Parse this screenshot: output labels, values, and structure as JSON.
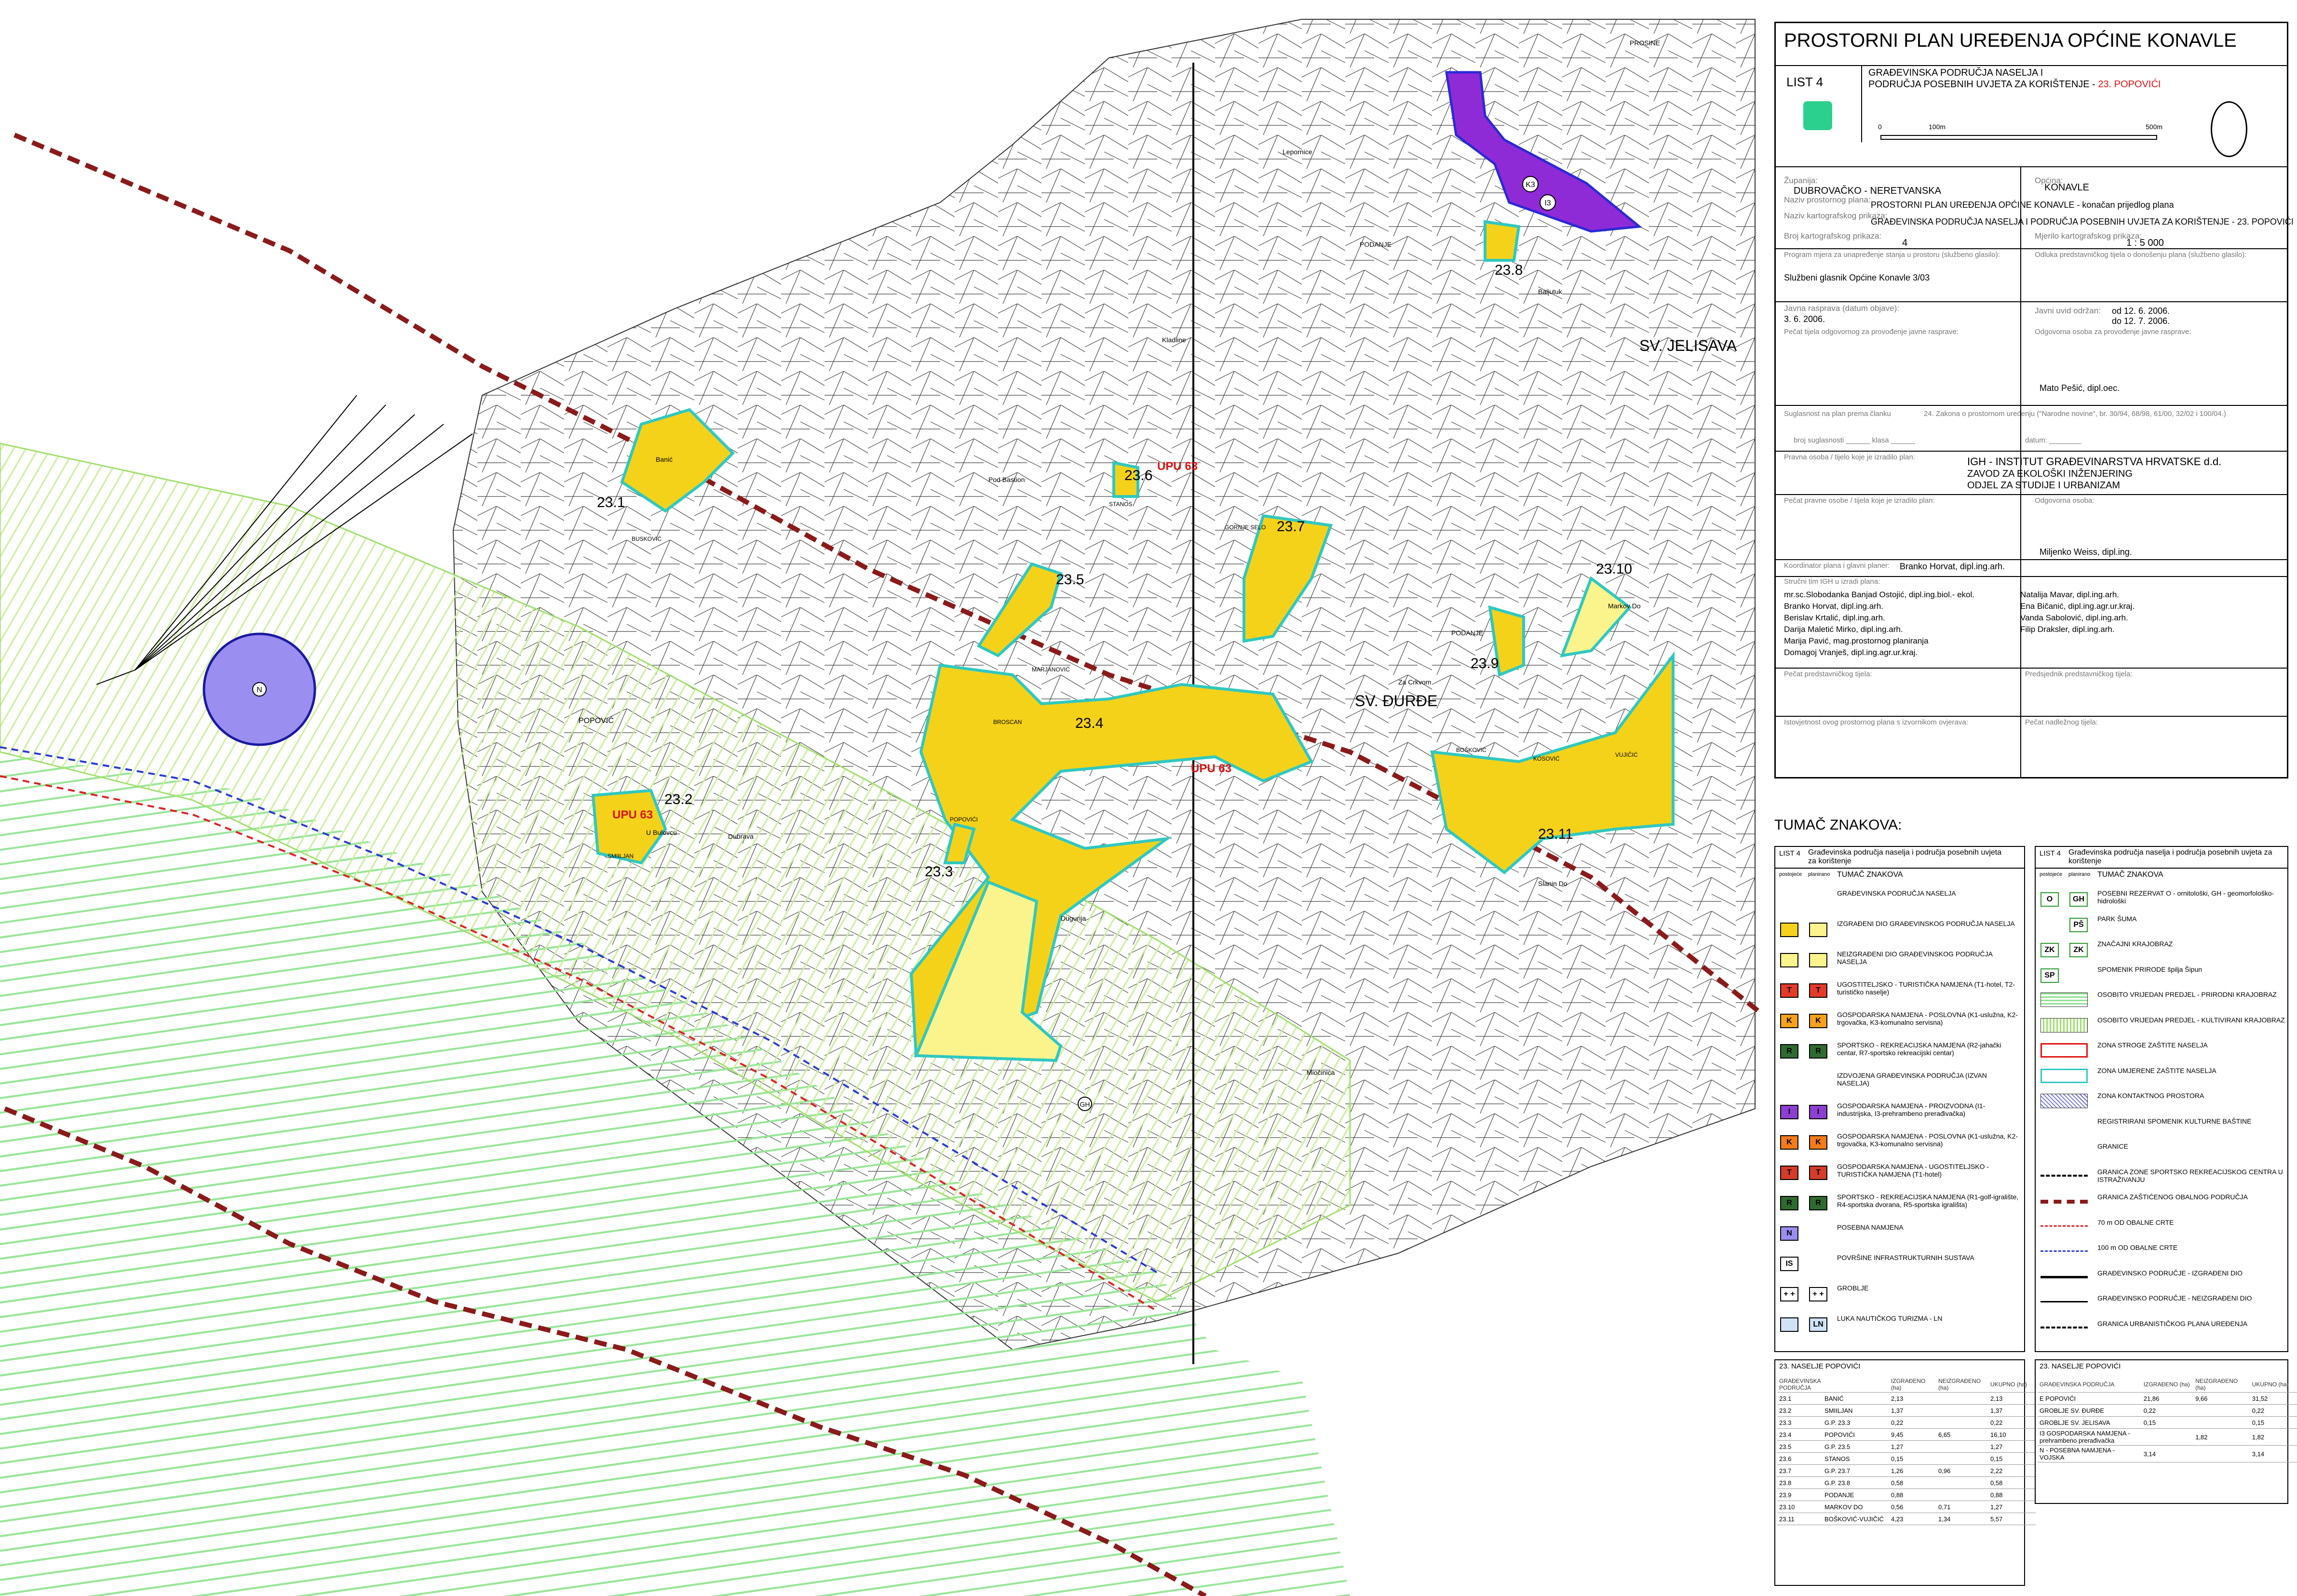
{
  "title": "PROSTORNI PLAN UREĐENJA OPĆINE KONAVLE",
  "sheet": {
    "list_no": "LIST 4",
    "subtitle_line1": "GRAĐEVINSKA PODRUČJA NASELJA I",
    "subtitle_line2": "PODRUČJA POSEBNIH UVJETA ZA KORIŠTENJE - ",
    "subtitle_highlight": "23. POPOVIĆI",
    "scale_bar": {
      "zero": "0",
      "mid": "100m",
      "end": "500m"
    },
    "fields": [
      {
        "label": "Županija:",
        "value": "DUBROVAČKO - NERETVANSKA"
      },
      {
        "label": "Općina:",
        "value": "KONAVLE"
      },
      {
        "label": "Naziv prostornog plana:",
        "value": "PROSTORNI PLAN UREĐENJA OPĆINE KONAVLE - konačan prijedlog plana"
      },
      {
        "label": "Naziv kartografskog prikaza:",
        "value": "GRAĐEVINSKA PODRUČJA NASELJA I PODRUČJA POSEBNIH UVJETA ZA KORIŠTENJE - 23. POPOVIĆI"
      },
      {
        "label": "Broj kartografskog prikaza:",
        "value": "4"
      },
      {
        "label": "Mjerilo kartografskog prikaza:",
        "value": "1 : 5 000"
      },
      {
        "label": "Program mjera za unapređenje stanja u prostoru (službeno glasilo):",
        "value": "Službeni glasnik Općine Konavle 3/03"
      },
      {
        "label": "Odluka predstavničkog tijela o donošenju plana (službeno glasilo):",
        "value": ""
      },
      {
        "label": "Javna rasprava (datum objave):",
        "value": "3. 6. 2006."
      },
      {
        "label": "Javni uvid održan:",
        "value": "od 12. 6. 2006. do 12. 7. 2006."
      },
      {
        "label": "Pečat tijela odgovornog za provođenje javne rasprave:",
        "value": ""
      },
      {
        "label": "Odgovorna osoba za provođenje javne rasprave:",
        "value": "Mato Pešić, dipl.oec."
      },
      {
        "label": "Suglasnost na plan prema članku",
        "value": "24. Zakona o prostornom uređenju (\"Narodne novine\", br. 30/94, 68/98, 61/00, 32/02 i 100/04.)"
      },
      {
        "label": "broj suglasnosti ______ klasa ______",
        "value": "datum: ________"
      },
      {
        "label": "Pravna osoba / tijelo koje je izradilo plan:",
        "value": "IGH - INSTITUT GRAĐEVINARSTVA HRVATSKE d.d."
      },
      {
        "label": "",
        "value": "ZAVOD ZA EKOLOŠKI INŽENJERING"
      },
      {
        "label": "",
        "value": "ODJEL ZA STUDIJE I URBANIZAM"
      },
      {
        "label": "Pečat pravne osobe / tijela koje je izradilo plan:",
        "value": ""
      },
      {
        "label": "Odgovorna osoba:",
        "value": "Miljenko Weiss, dipl.ing."
      },
      {
        "label": "Koordinator plana i glavni planer:",
        "value": "Branko Horvat, dipl.ing.arh."
      },
      {
        "label": "Stručni tim IGH u izradi plana:",
        "value": ""
      },
      {
        "label": "Pečat predstavničkog tijela:",
        "value": ""
      },
      {
        "label": "Predsjednik predstavničkog tijela:",
        "value": ""
      },
      {
        "label": "Istovjetnost ovog prostornog plana s izvornikom ovjerava:",
        "value": ""
      },
      {
        "label": "Pečat nadležnog tijela:",
        "value": ""
      }
    ],
    "team_left": [
      "mr.sc.Slobodanka Banjad Ostojić, dipl.ing.biol.- ekol.",
      "Branko Horvat, dipl.ing.arh.",
      "Berislav Krtalić, dipl.ing.arh.",
      "Darija Maletić Mirko, dipl.ing.arh.",
      "Marija Pavić, mag.prostornog planiranja",
      "Domagoj Vranješ, dipl.ing.agr.ur.kraj."
    ],
    "team_right": [
      "Natalija Mavar, dipl.ing.arh.",
      "Ena Bičanić, dipl.ing.agr.ur.kraj.",
      "Vanda Sabolović, dipl.ing.arh.",
      "Filip Draksler, dipl.ing.arh."
    ]
  },
  "legend": {
    "heading": "TUMAČ ZNAKOVA:",
    "left_header": "Građevinska područja naselja i područja posebnih uvjeta za korištenje",
    "left_sub": "TUMAČ ZNAKOVA",
    "right_header": "Građevinska područja naselja i područja posebnih uvjeta za korištenje",
    "right_sub": "TUMAČ ZNAKOVA",
    "col_a": "postojeće",
    "col_b": "planirano",
    "left_items": [
      {
        "text": "GRAĐEVINSKA PODRUČJA NASELJA",
        "a": "",
        "b": "",
        "color": ""
      },
      {
        "text": "IZGRAĐENI DIO GRAĐEVINSKOG PODRUČJA NASELJA",
        "a": "",
        "b": "",
        "color": "#f5d21a"
      },
      {
        "text": "NEIZGRAĐENI DIO GRAĐEVINSKOG PODRUČJA NASELJA",
        "a": "",
        "b": "",
        "color": "#fbf48c"
      },
      {
        "text": "UGOSTITELJSKO - TURISTIČKA NAMJENA (T1-hotel, T2-turističko naselje)",
        "a": "T",
        "b": "T",
        "color": "#e43a2a"
      },
      {
        "text": "GOSPODARSKA NAMJENA - POSLOVNA (K1-uslužna, K2-trgovačka, K3-komunalno servisna)",
        "a": "K",
        "b": "K",
        "color": "#f7a21b"
      },
      {
        "text": "SPORTSKO - REKREACIJSKA NAMJENA (R2-jahački centar, R7-sportsko rekreacijski centar)",
        "a": "R",
        "b": "R",
        "color": "#2f6b2f"
      },
      {
        "text": "IZDVOJENA GRAĐEVINSKA PODRUČJA (IZVAN NASELJA)",
        "a": "",
        "b": "",
        "color": ""
      },
      {
        "text": "GOSPODARSKA NAMJENA - PROIZVODNA (I1-industrijska, I3-prehrambeno prerađivačka)",
        "a": "I",
        "b": "I",
        "color": "#8d3fd1"
      },
      {
        "text": "GOSPODARSKA NAMJENA - POSLOVNA (K1-uslužna, K2-trgovačka, K3-komunalno servisna)",
        "a": "K",
        "b": "K",
        "color": "#f47b1b"
      },
      {
        "text": "GOSPODARSKA NAMJENA - UGOSTITELJSKO - TURISTIČKA NAMJENA (T1-hotel)",
        "a": "T",
        "b": "T",
        "color": "#d43c2b"
      },
      {
        "text": "SPORTSKO - REKREACIJSKA NAMJENA (R1-golf-igralište, R4-sportska dvorana, R5-sportska igrališta)",
        "a": "R",
        "b": "R",
        "color": "#2f6b2f"
      },
      {
        "text": "POSEBNA NAMJENA",
        "a": "N",
        "b": "",
        "color": "#9a8ef0"
      },
      {
        "text": "POVRŠINE INFRASTRUKTURNIH SUSTAVA",
        "a": "IS",
        "b": "",
        "color": "#ffffff"
      },
      {
        "text": "GROBLJE",
        "a": "+ +",
        "b": "+ +",
        "color": "#ffffff"
      },
      {
        "text": "LUKA NAUTIČKOG TURIZMA - LN",
        "a": "",
        "b": "LN",
        "color": "#cfe3f5"
      }
    ],
    "right_items": [
      {
        "text": "POSEBNI REZERVAT O - ornitološki, GH - geomorfološko-hidrološki",
        "a": "O",
        "b": "GH"
      },
      {
        "text": "PARK ŠUMA",
        "a": "",
        "b": "PŠ"
      },
      {
        "text": "ZNAČAJNI KRAJOBRAZ",
        "a": "ZK",
        "b": "ZK"
      },
      {
        "text": "SPOMENIK PRIRODE špilja Šipun",
        "a": "SP",
        "b": ""
      },
      {
        "text": "OSOBITO VRIJEDAN PREDJEL - PRIRODNI KRAJOBRAZ",
        "a": "",
        "b": ""
      },
      {
        "text": "OSOBITO VRIJEDAN PREDJEL - KULTIVIRANI KRAJOBRAZ",
        "a": "",
        "b": ""
      },
      {
        "text": "ZONA STROGE ZAŠTITE NASELJA",
        "a": "",
        "b": ""
      },
      {
        "text": "ZONA UMJERENE ZAŠTITE NASELJA",
        "a": "",
        "b": ""
      },
      {
        "text": "ZONA KONTAKTNOG PROSTORA",
        "a": "",
        "b": ""
      },
      {
        "text": "REGISTRIRANI SPOMENIK KULTURNE BAŠTINE",
        "a": "",
        "b": ""
      },
      {
        "text": "GRANICE",
        "a": "",
        "b": ""
      },
      {
        "text": "GRANICA ZONE SPORTSKO REKREACIJSKOG CENTRA U ISTRAŽIVANJU",
        "a": "",
        "b": ""
      },
      {
        "text": "GRANICA ZAŠTIĆENOG OBALNOG PODRUČJA",
        "a": "",
        "b": ""
      },
      {
        "text": "70 m OD OBALNE CRTE",
        "a": "",
        "b": ""
      },
      {
        "text": "100 m OD OBALNE CRTE",
        "a": "",
        "b": ""
      },
      {
        "text": "GRAĐEVINSKO PODRUČJE - IZGRAĐENI DIO",
        "a": "",
        "b": ""
      },
      {
        "text": "GRAĐEVINSKO PODRUČJE - NEIZGRAĐENI DIO",
        "a": "",
        "b": ""
      },
      {
        "text": "GRANICA URBANISTIČKOG PLANA UREĐENJA",
        "a": "",
        "b": ""
      }
    ]
  },
  "stats": {
    "left_title": "23. NASELJE POPOVIĆI",
    "left_headers": [
      "GRAĐEVINSKA PODRUČJA",
      "",
      "IZGRAĐENO (ha)",
      "NEIZGRAĐENO (ha)",
      "UKUPNO (ha)"
    ],
    "left_rows": [
      [
        "23.1",
        "BANIĆ",
        "2,13",
        "",
        "2,13"
      ],
      [
        "23.2",
        "SMIILJAN",
        "1,37",
        "",
        "1,37"
      ],
      [
        "23.3",
        "G.P. 23.3",
        "0,22",
        "",
        "0,22"
      ],
      [
        "23.4",
        "POPOVIĆI",
        "9,45",
        "6,65",
        "16,10"
      ],
      [
        "23.5",
        "G.P. 23.5",
        "1,27",
        "",
        "1,27"
      ],
      [
        "23.6",
        "STANOS",
        "0,15",
        "",
        "0,15"
      ],
      [
        "23.7",
        "G.P. 23.7",
        "1,26",
        "0,96",
        "2,22"
      ],
      [
        "23.8",
        "G.P. 23.8",
        "0,58",
        "",
        "0,58"
      ],
      [
        "23.9",
        "PODANJE",
        "0,88",
        "",
        "0,88"
      ],
      [
        "23.10",
        "MARKOV DO",
        "0,56",
        "0,71",
        "1,27"
      ],
      [
        "23.11",
        "BOŠKOVIĆ-VUJIČIĆ",
        "4,23",
        "1,34",
        "5,57"
      ]
    ],
    "right_title": "23. NASELJE POPOVIĆI",
    "right_headers": [
      "GRAĐEVINSKA PODRUČJA",
      "IZGRAĐENO (ha)",
      "NEIZGRAĐENO (ha)",
      "UKUPNO (ha)"
    ],
    "right_rows": [
      [
        "E POPOVIĆI",
        "21,86",
        "9,66",
        "31,52"
      ],
      [
        "GROBLJE SV. ĐURĐE",
        "0,22",
        "",
        "0,22"
      ],
      [
        "GROBLJE SV. JELISAVA",
        "0,15",
        "",
        "0,15"
      ],
      [
        "I3 GOSPODARSKA NAMJENA - prehrambeno prerađivačka",
        "",
        "1,82",
        "1,82"
      ],
      [
        "N - POSEBNA NAMJENA - VOJSKA",
        "3,14",
        "",
        "3,14"
      ]
    ]
  },
  "map": {
    "zone_labels": [
      "23.1",
      "23.2",
      "23.3",
      "23.4",
      "23.5",
      "23.6",
      "23.7",
      "23.8",
      "23.9",
      "23.10",
      "23.11"
    ],
    "upu_labels": [
      "UPU 63",
      "UPU 63",
      "UPU 63"
    ],
    "places": [
      "SV. ĐURĐE",
      "SV. JELISAVA",
      "POPOVIĆ",
      "Lepornice",
      "PODANJE",
      "Dubrava",
      "Dugurija",
      "Miočinica",
      "Banić",
      "BUSKOVIĆ",
      "Pod Bastion",
      "STANOS",
      "GORNJE SELO",
      "BROSCAN",
      "MARJANOVIĆ",
      "POPOVIĆI",
      "SMIILJAN",
      "PODANJE",
      "Markov Do",
      "Slanin Do",
      "VUJIČIĆ",
      "KOSOVIĆ",
      "BOŠKOVIĆ",
      "Za Crkvom",
      "U Bulovcu",
      "Kladline",
      "Baljutuk",
      "PROSINE"
    ],
    "symbols": {
      "military": "N",
      "k3": "K3",
      "i3": "I3",
      "gh": "GH"
    }
  },
  "colors": {
    "built": "#f5d21a",
    "unbuilt": "#fbf48c",
    "zone_outline": "#30c8c0",
    "military": "#9a8ef0",
    "industrial": "#8f2bd6",
    "coastal_border": "#8b1a1a",
    "green_hatch": "#8fe08f"
  }
}
